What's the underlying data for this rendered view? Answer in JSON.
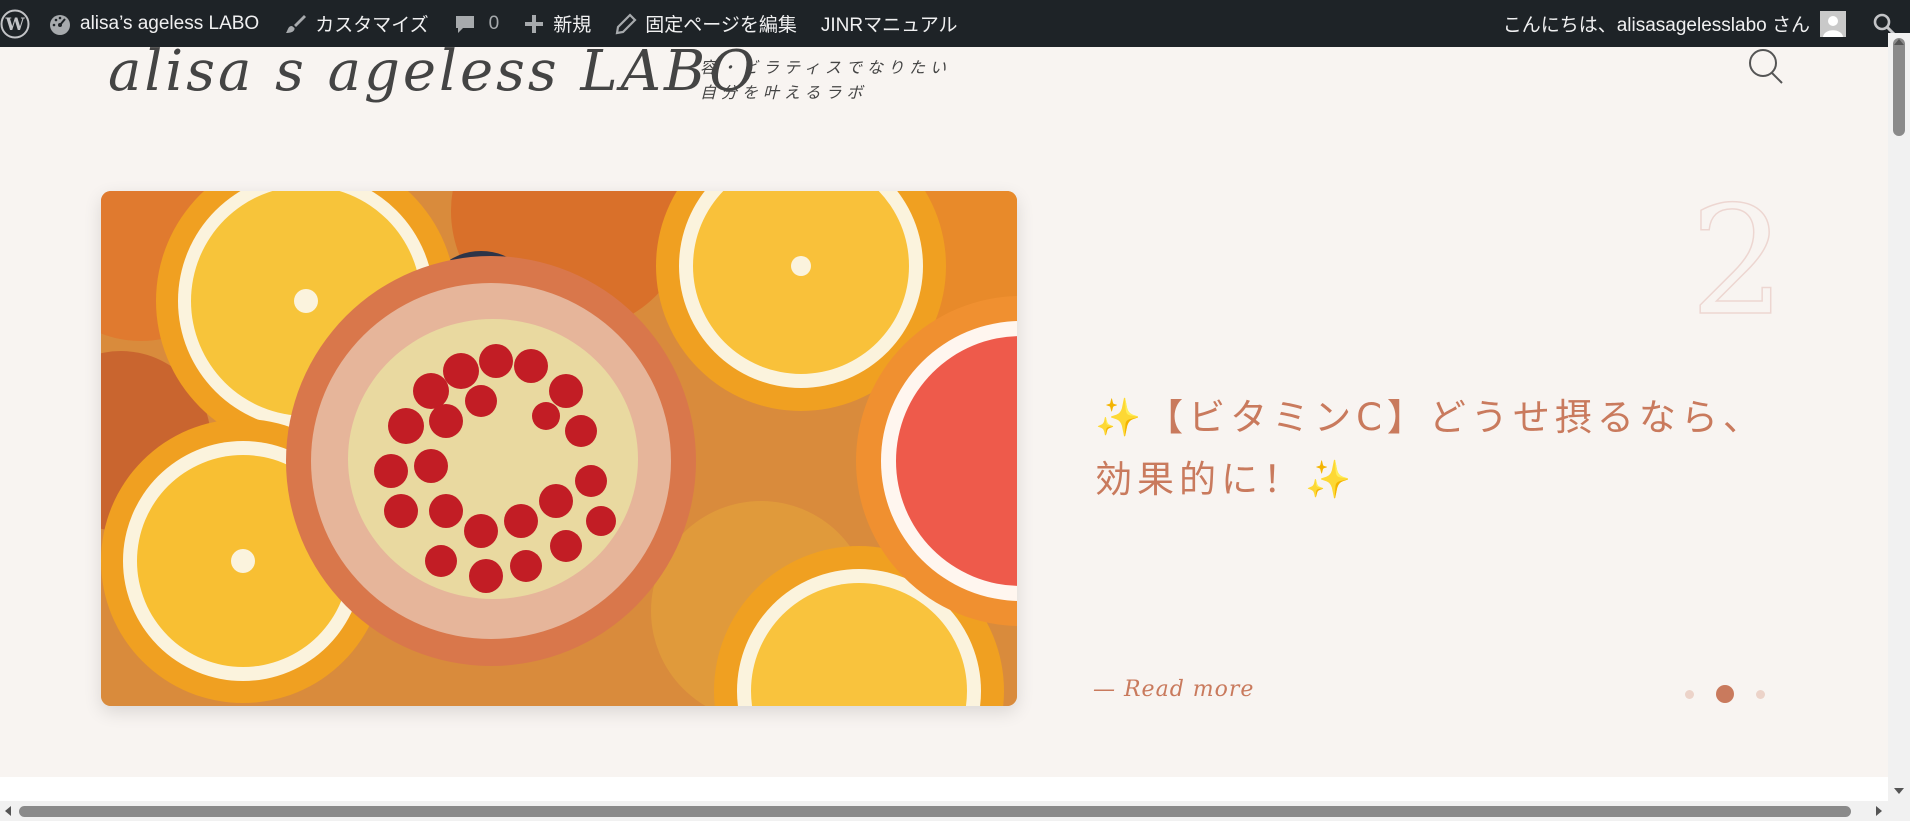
{
  "admin_bar": {
    "wp_logo_icon": "wordpress-logo-icon",
    "site_name": "alisa’s ageless LABO",
    "customize": "カスタマイズ",
    "comments_count": "0",
    "new": "新規",
    "edit_page": "固定ページを編集",
    "manual": "JINRマニュアル",
    "greeting": "こんにちは、alisasagelesslabo さん",
    "icons": [
      "dashboard-icon",
      "brush-icon",
      "comment-icon",
      "plus-icon",
      "pencil-icon",
      "avatar-icon",
      "search-icon"
    ]
  },
  "header": {
    "site_title": "alisa s ageless LABO",
    "tagline": "容・ビラティスでなりたい自分を叶えるラボ"
  },
  "slider": {
    "slide_number": "2",
    "post_title": "✨【ビタミンC】どうせ摂るなら、効果的に！✨",
    "read_more": "— Read more",
    "dots_total": 3,
    "active_dot": 2
  },
  "colors": {
    "admin_bar_bg": "#1e2327",
    "page_bg": "#f8f4f1",
    "accent": "#c97a5d"
  }
}
